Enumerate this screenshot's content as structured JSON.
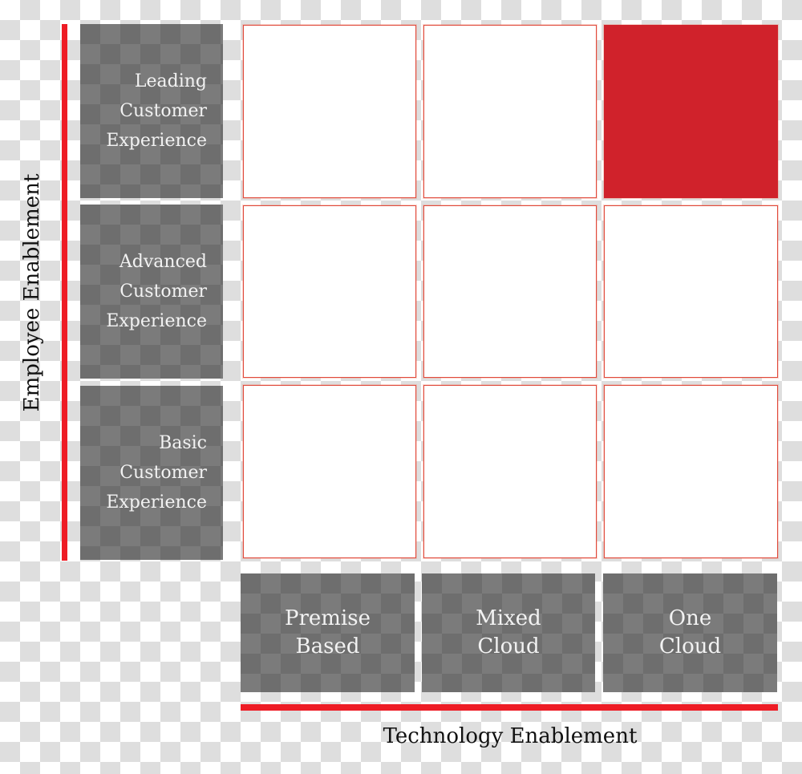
{
  "diagram": {
    "type": "3x3 maturity matrix",
    "y_axis": {
      "title": "Employee Enablement",
      "levels": [
        "Leading\nCustomer\nExperience",
        "Advanced\nCustomer\nExperience",
        "Basic\nCustomer\nExperience"
      ]
    },
    "x_axis": {
      "title": "Technology Enablement",
      "levels": [
        "Premise\nBased",
        "Mixed\nCloud",
        "One\nCloud"
      ]
    },
    "highlighted_cell": {
      "row": "Leading Customer Experience",
      "column": "One Cloud"
    },
    "colors": {
      "accent": "#ee1c25",
      "highlight": "#d0222b",
      "cell_border": "#e04a3c",
      "label_box": "#6e6e6e"
    }
  }
}
